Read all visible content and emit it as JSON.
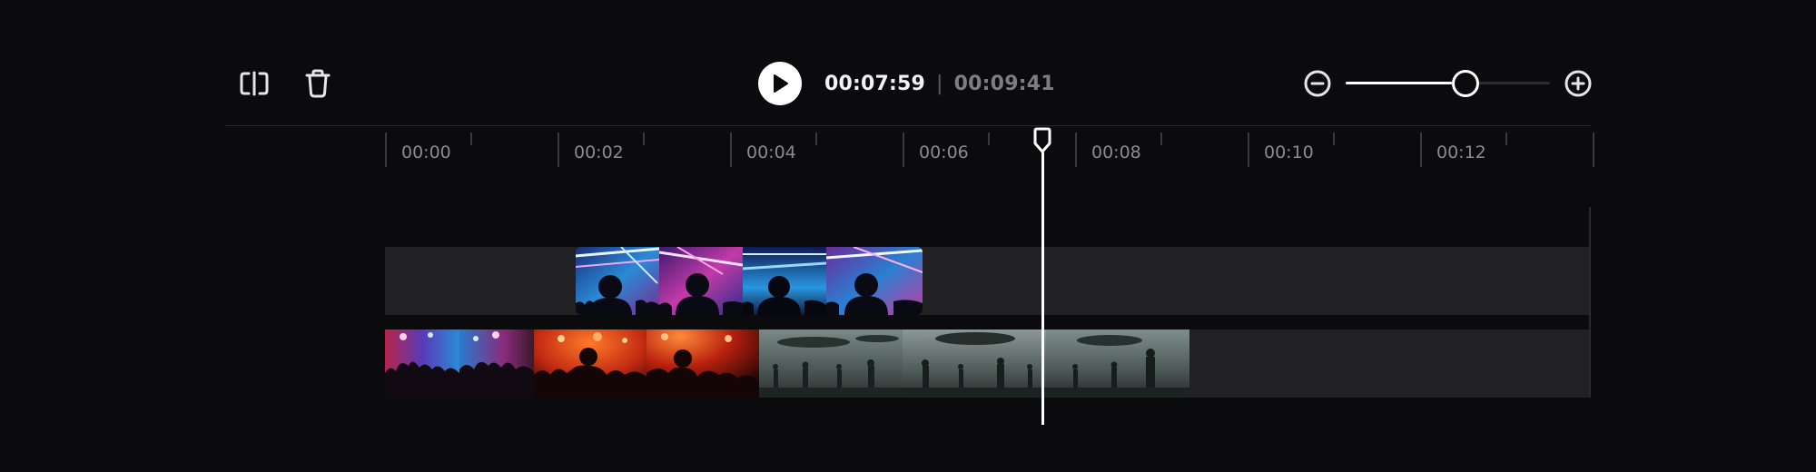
{
  "toolbar": {
    "split_icon": "split-icon",
    "delete_icon": "trash-icon",
    "play_icon": "play-icon",
    "current_time": "00:07:59",
    "separator": "|",
    "total_time": "00:09:41",
    "zoom_out_icon": "zoom-out-icon",
    "zoom_in_icon": "zoom-in-icon",
    "zoom_level": 0.58
  },
  "ruler": {
    "labels": [
      "00:00",
      "00:02",
      "00:04",
      "00:06",
      "00:08",
      "00:10",
      "00:12"
    ]
  },
  "timeline": {
    "playhead_time": "00:07:59",
    "tracks": [
      {
        "name": "overlay-track",
        "clips": [
          {
            "name": "neon-concert-clip",
            "frames": 4
          }
        ]
      },
      {
        "name": "main-track",
        "clips": [
          {
            "name": "concert-crowd-clip",
            "frames": 2
          },
          {
            "name": "red-stage-clip",
            "frames": 2
          },
          {
            "name": "robot-invasion-clip",
            "frames": 3
          }
        ]
      }
    ]
  },
  "colors": {
    "background": "#0b0b0d",
    "track": "#212123",
    "playhead": "#ffffff",
    "text_primary": "#f2f2f2",
    "text_secondary": "#7d7d82"
  }
}
